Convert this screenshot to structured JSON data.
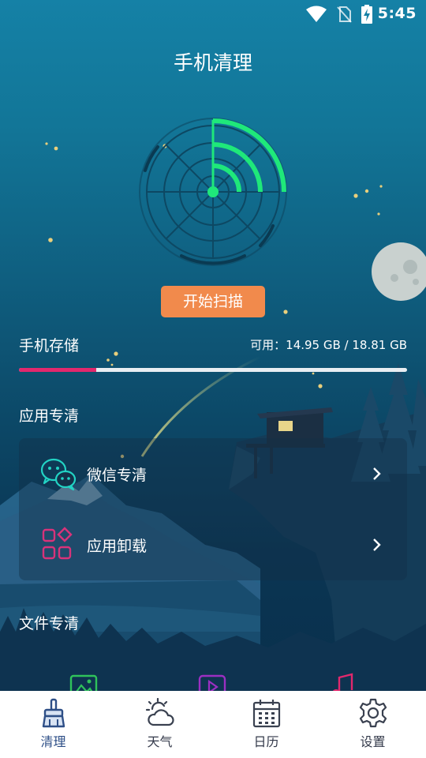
{
  "status_bar": {
    "time": "5:45"
  },
  "header": {
    "title": "手机清理"
  },
  "scan": {
    "button_label": "开始扫描"
  },
  "storage": {
    "label": "手机存储",
    "value_text": "可用：14.95 GB /  18.81 GB",
    "available_gb": 14.95,
    "total_gb": 18.81,
    "used_fraction": 0.2,
    "bar_color": "#e2286d"
  },
  "app_clean": {
    "title": "应用专清",
    "items": [
      {
        "label": "微信专清",
        "icon": "wechat-icon"
      },
      {
        "label": "应用卸载",
        "icon": "apps-icon"
      }
    ]
  },
  "file_clean": {
    "title": "文件专清",
    "items": [
      {
        "icon": "image-icon"
      },
      {
        "icon": "video-icon"
      },
      {
        "icon": "music-icon"
      }
    ]
  },
  "tabs": [
    {
      "label": "清理",
      "icon": "broom-icon",
      "active": true
    },
    {
      "label": "天气",
      "icon": "weather-icon",
      "active": false
    },
    {
      "label": "日历",
      "icon": "calendar-icon",
      "active": false
    },
    {
      "label": "设置",
      "icon": "settings-icon",
      "active": false
    }
  ],
  "colors": {
    "accent": "#f18a4c",
    "radar": "#1fe87a",
    "active_tab": "#2e4f87"
  }
}
